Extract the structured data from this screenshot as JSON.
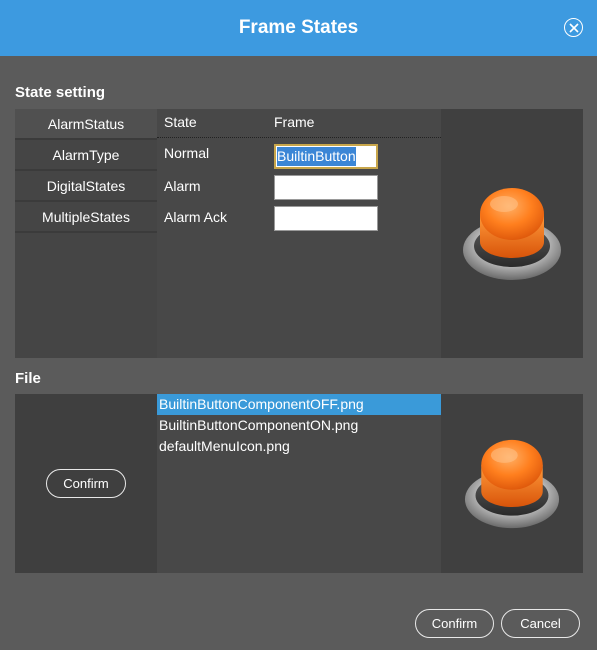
{
  "dialog": {
    "title": "Frame States",
    "close_icon": "close-icon"
  },
  "state_setting": {
    "label": "State setting",
    "categories": [
      "AlarmStatus",
      "AlarmType",
      "DigitalStates",
      "MultipleStates"
    ],
    "active_category": "AlarmStatus",
    "headers": {
      "state": "State",
      "frame": "Frame"
    },
    "rows": [
      {
        "state": "Normal",
        "frame": "BuiltinButton"
      },
      {
        "state": "Alarm",
        "frame": ""
      },
      {
        "state": "Alarm Ack",
        "frame": ""
      }
    ],
    "preview_icon": "orange-push-button-icon"
  },
  "file": {
    "label": "File",
    "confirm_label": "Confirm",
    "files": [
      "BuiltinButtonComponentOFF.png",
      "BuiltinButtonComponentON.png",
      "defaultMenuIcon.png"
    ],
    "selected_file": "BuiltinButtonComponentOFF.png",
    "preview_icon": "orange-push-button-icon"
  },
  "footer": {
    "confirm_label": "Confirm",
    "cancel_label": "Cancel"
  },
  "colors": {
    "titlebar": "#3d9ae0",
    "background": "#5b5b5b",
    "selection": "#3a9ad9",
    "button_orange": "#f07c1a"
  }
}
